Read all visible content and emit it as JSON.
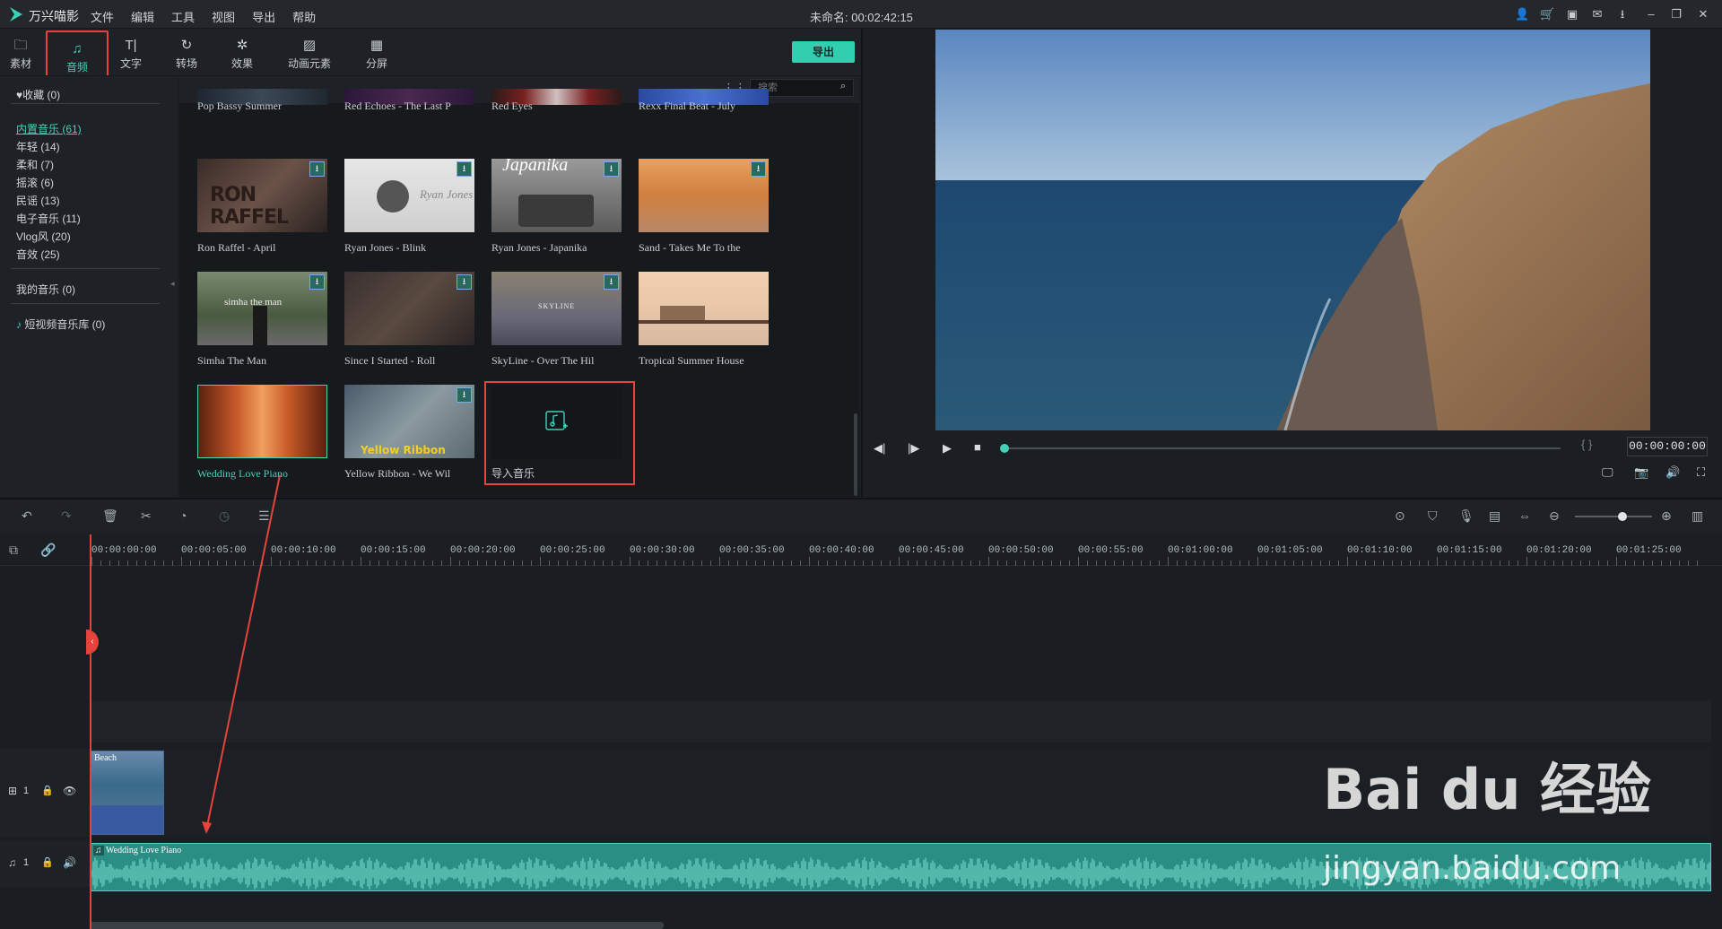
{
  "app": {
    "name": "万兴喵影",
    "project_title": "未命名: 00:02:42:15"
  },
  "menu": [
    "文件",
    "编辑",
    "工具",
    "视图",
    "导出",
    "帮助"
  ],
  "tabs": [
    {
      "label": "素材",
      "icon": "folder-icon"
    },
    {
      "label": "音频",
      "icon": "music-note-icon",
      "active": true
    },
    {
      "label": "文字",
      "icon": "text-icon"
    },
    {
      "label": "转场",
      "icon": "transition-icon"
    },
    {
      "label": "效果",
      "icon": "effects-icon"
    },
    {
      "label": "动画元素",
      "icon": "image-icon"
    },
    {
      "label": "分屏",
      "icon": "split-screen-icon"
    }
  ],
  "export_label": "导出",
  "search_placeholder": "搜索",
  "sidebar": {
    "favorites": "收藏 (0)",
    "builtin": "内置音乐 (61)",
    "categories": [
      "年轻 (14)",
      "柔和 (7)",
      "摇滚 (6)",
      "民谣 (13)",
      "电子音乐 (11)",
      "Vlog风 (20)",
      "音效 (25)"
    ],
    "my_music": "我的音乐 (0)",
    "short_video": "短视频音乐库 (0)"
  },
  "tiles": [
    {
      "title": "Pop Bassy Summer"
    },
    {
      "title": "Red Echoes - The Last P"
    },
    {
      "title": "Red Eyes"
    },
    {
      "title": "Rexx Final Beat - July"
    },
    {
      "title": "Ron Raffel - April",
      "thumb_text": "RON RAFFEL"
    },
    {
      "title": "Ryan Jones - Blink",
      "thumb_text": "Ryan Jones"
    },
    {
      "title": "Ryan Jones - Japanika",
      "thumb_text": "Japanika"
    },
    {
      "title": "Sand - Takes Me To the"
    },
    {
      "title": "Simha The Man",
      "thumb_text": "simha the man"
    },
    {
      "title": "Since I Started - Roll"
    },
    {
      "title": "SkyLine - Over The Hil",
      "thumb_text": "SKYLINE"
    },
    {
      "title": "Tropical Summer House"
    },
    {
      "title": "Wedding Love Piano"
    },
    {
      "title": "Yellow Ribbon - We Wil",
      "thumb_text": "Yellow Ribbon"
    }
  ],
  "import_label": "导入音乐",
  "preview": {
    "timecode": "00:00:00:00",
    "progress": 0
  },
  "ruler_ticks": [
    "00:00:00:00",
    "00:00:05:00",
    "00:00:10:00",
    "00:00:15:00",
    "00:00:20:00",
    "00:00:25:00",
    "00:00:30:00",
    "00:00:35:00",
    "00:00:40:00",
    "00:00:45:00",
    "00:00:50:00",
    "00:00:55:00",
    "00:01:00:00",
    "00:01:05:00",
    "00:01:10:00",
    "00:01:15:00",
    "00:01:20:00",
    "00:01:25:00"
  ],
  "tracks": {
    "video_label": "1",
    "audio_label": "1",
    "video_clip": "Beach",
    "audio_clip": "Wedding Love Piano"
  },
  "watermark": {
    "brand": "Bai du 经验",
    "url": "jingyan.baidu.com"
  },
  "colors": {
    "accent": "#2fcfb0",
    "highlight_box": "#e5433b",
    "audio_clip": "#2a8e84"
  }
}
